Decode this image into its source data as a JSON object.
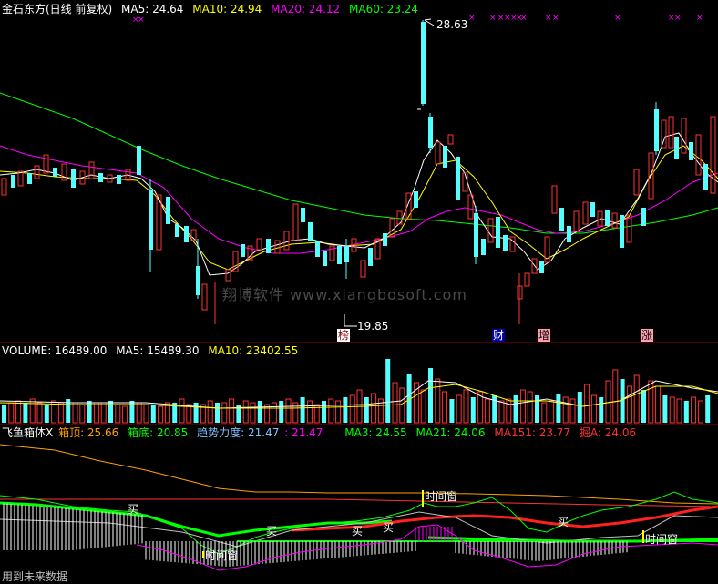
{
  "main_header": {
    "title": "金石东方(日线 前复权)",
    "ma5": "MA5: 24.64",
    "ma10": "MA10: 24.94",
    "ma20": "MA20: 24.12",
    "ma60": "MA60: 23.24"
  },
  "price_annotations": {
    "high": "28.63",
    "low": "19.85"
  },
  "event_tags": [
    "榜",
    "财",
    "增",
    "涨"
  ],
  "watermark": "翔博软件 www.xiangbosoft.com",
  "volume_header": {
    "label": "VOLUME: 16489.00",
    "ma5": "MA5: 15489.30",
    "ma10": "MA10: 23402.55"
  },
  "indicator_header": {
    "name": "飞鱼箱体X",
    "box_top": "箱顶: 25.66",
    "box_bottom": "箱底: 20.85",
    "trend": "趋势力度: 21.47",
    "trend2": ": 21.47",
    "ma3": "MA3: 24.55",
    "ma21": "MA21: 24.06",
    "ma151": "MA151: 23.77",
    "jue": "掘A: 24.06"
  },
  "indicator_labels": {
    "buy": "买",
    "time_window": "时间窗"
  },
  "footer": "用到未来数据",
  "colors": {
    "up": "#ff3232",
    "down": "#54ffff",
    "ma5": "#ffffff",
    "ma10": "#ffff00",
    "ma20": "#ff00ff",
    "ma60": "#00ff00",
    "axis": "#8b0000"
  }
}
